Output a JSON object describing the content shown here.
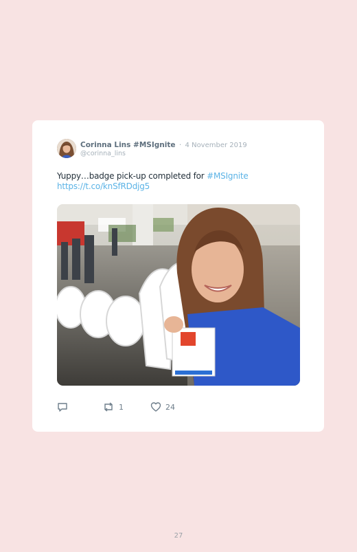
{
  "tweet": {
    "author_name": "Corinna Lins #MSIgnite",
    "separator": "·",
    "date": "4 November 2019",
    "handle": "@corinna_lins",
    "text_prefix": "Yuppy…badge pick-up completed for ",
    "hashtag": "#MSIgnite",
    "link": "https://t.co/knSfRDdjg5",
    "avatar_icon": "avatar",
    "photo_icon": "selfie-photo"
  },
  "actions": {
    "reply_icon": "reply-icon",
    "retweet_icon": "retweet-icon",
    "retweet_count": "1",
    "like_icon": "heart-icon",
    "like_count": "24"
  },
  "page": {
    "number": "27"
  },
  "colors": {
    "background": "#f8e3e3",
    "card": "#ffffff",
    "link": "#5bb3e6",
    "muted": "#a6b1ba"
  }
}
